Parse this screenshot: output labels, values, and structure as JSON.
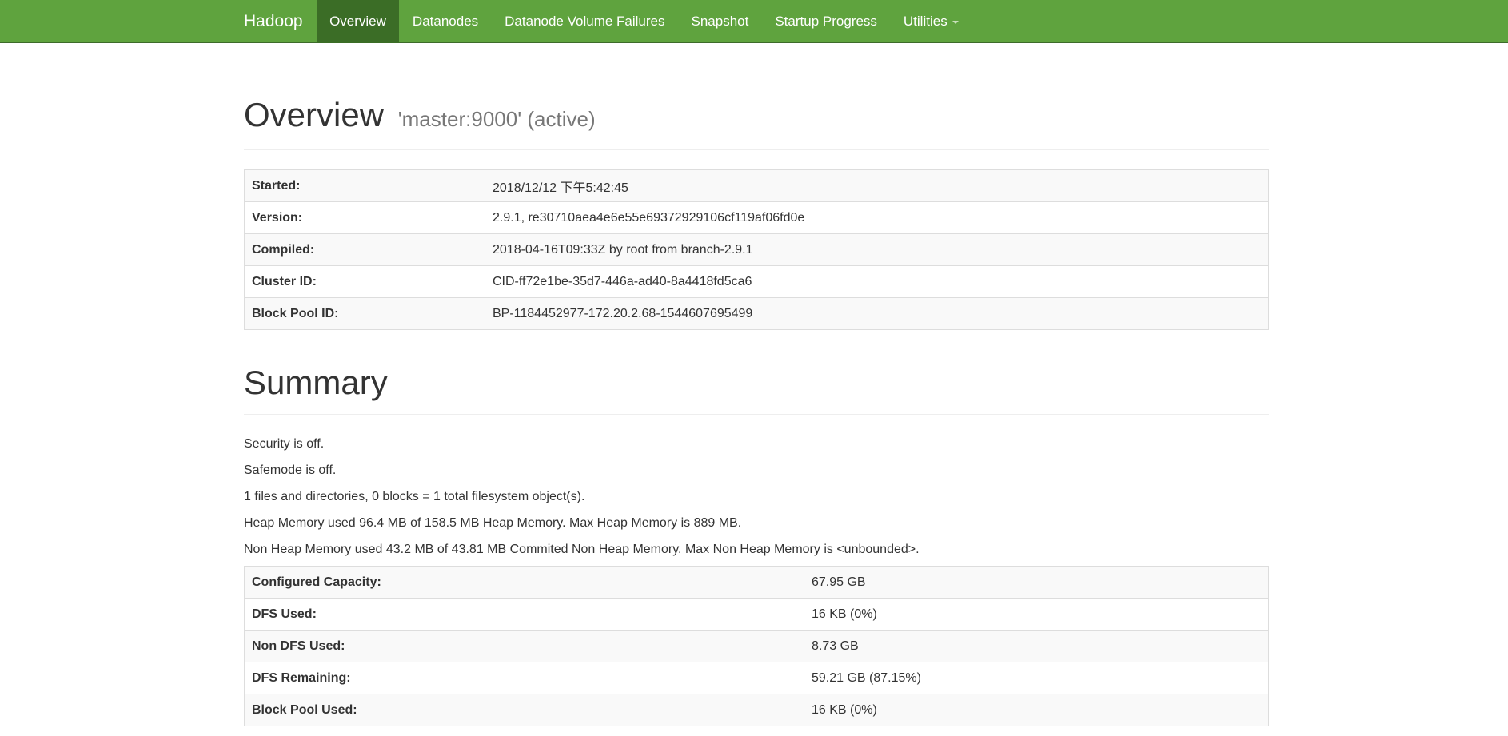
{
  "navbar": {
    "brand": "Hadoop",
    "items": [
      {
        "label": "Overview"
      },
      {
        "label": "Datanodes"
      },
      {
        "label": "Datanode Volume Failures"
      },
      {
        "label": "Snapshot"
      },
      {
        "label": "Startup Progress"
      },
      {
        "label": "Utilities"
      }
    ],
    "active_index": 0,
    "background": "#5fa33e",
    "active_background": "#3b6d26"
  },
  "overview": {
    "title": "Overview",
    "subtitle": "'master:9000' (active)",
    "rows": [
      {
        "label": "Started:",
        "value": "2018/12/12 下午5:42:45"
      },
      {
        "label": "Version:",
        "value": "2.9.1, re30710aea4e6e55e69372929106cf119af06fd0e"
      },
      {
        "label": "Compiled:",
        "value": "2018-04-16T09:33Z by root from branch-2.9.1"
      },
      {
        "label": "Cluster ID:",
        "value": "CID-ff72e1be-35d7-446a-ad40-8a4418fd5ca6"
      },
      {
        "label": "Block Pool ID:",
        "value": "BP-1184452977-172.20.2.68-1544607695499"
      }
    ]
  },
  "summary": {
    "title": "Summary",
    "lines": [
      "Security is off.",
      "Safemode is off.",
      "1 files and directories, 0 blocks = 1 total filesystem object(s).",
      "Heap Memory used 96.4 MB of 158.5 MB Heap Memory. Max Heap Memory is 889 MB.",
      "Non Heap Memory used 43.2 MB of 43.81 MB Commited Non Heap Memory. Max Non Heap Memory is <unbounded>."
    ],
    "rows": [
      {
        "label": "Configured Capacity:",
        "value": "67.95 GB"
      },
      {
        "label": "DFS Used:",
        "value": "16 KB (0%)"
      },
      {
        "label": "Non DFS Used:",
        "value": "8.73 GB"
      },
      {
        "label": "DFS Remaining:",
        "value": "59.21 GB (87.15%)"
      },
      {
        "label": "Block Pool Used:",
        "value": "16 KB (0%)"
      }
    ]
  }
}
